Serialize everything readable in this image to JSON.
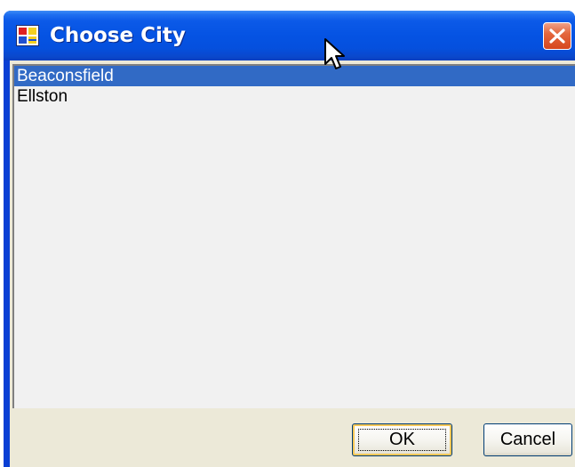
{
  "window": {
    "title": "Choose City",
    "icon": "application-icon",
    "close_icon": "close-icon"
  },
  "city_list": {
    "items": [
      {
        "label": "Beaconsfield",
        "selected": true
      },
      {
        "label": "Ellston",
        "selected": false
      }
    ]
  },
  "buttons": {
    "ok_label": "OK",
    "cancel_label": "Cancel"
  },
  "colors": {
    "titlebar": "#0553e3",
    "selection": "#316ac5",
    "close_button": "#d6461e",
    "dialog_face": "#ece9d8"
  }
}
